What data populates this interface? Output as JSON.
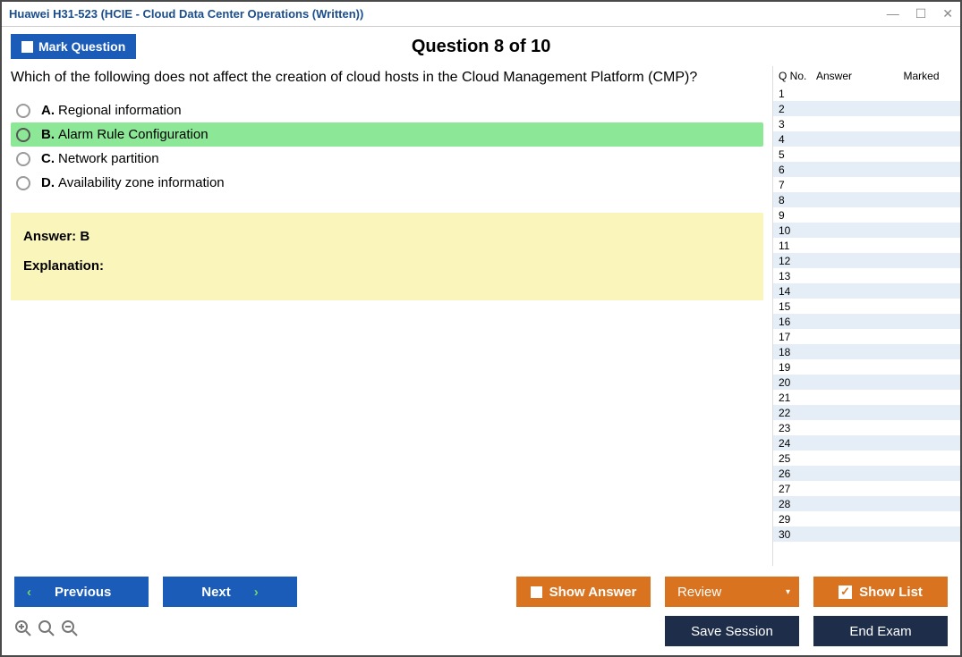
{
  "window": {
    "title": "Huawei H31-523 (HCIE - Cloud Data Center Operations (Written))"
  },
  "header": {
    "mark_label": "Mark Question",
    "question_label": "Question 8 of 10"
  },
  "question": {
    "text": "Which of the following does not affect the creation of cloud hosts in the Cloud Management Platform (CMP)?",
    "options": [
      {
        "letter": "A.",
        "text": "Regional information",
        "selected": false
      },
      {
        "letter": "B.",
        "text": "Alarm Rule Configuration",
        "selected": true
      },
      {
        "letter": "C.",
        "text": "Network partition",
        "selected": false
      },
      {
        "letter": "D.",
        "text": "Availability zone information",
        "selected": false
      }
    ]
  },
  "answer": {
    "label": "Answer: B",
    "explanation_label": "Explanation:"
  },
  "sidebar": {
    "headers": {
      "qno": "Q No.",
      "answer": "Answer",
      "marked": "Marked"
    },
    "rows": [
      "1",
      "2",
      "3",
      "4",
      "5",
      "6",
      "7",
      "8",
      "9",
      "10",
      "11",
      "12",
      "13",
      "14",
      "15",
      "16",
      "17",
      "18",
      "19",
      "20",
      "21",
      "22",
      "23",
      "24",
      "25",
      "26",
      "27",
      "28",
      "29",
      "30"
    ]
  },
  "footer": {
    "previous": "Previous",
    "next": "Next",
    "show_answer": "Show Answer",
    "review": "Review",
    "show_list": "Show List",
    "save_session": "Save Session",
    "end_exam": "End Exam"
  }
}
